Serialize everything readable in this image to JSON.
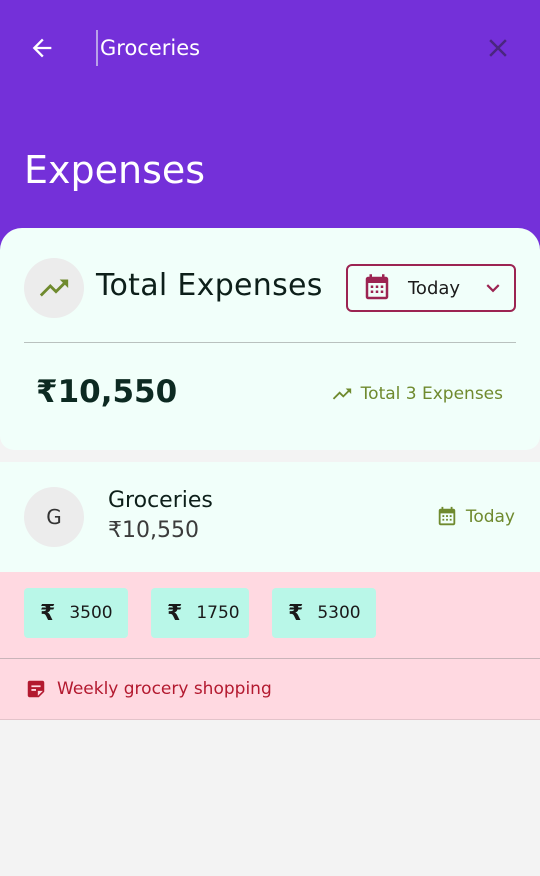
{
  "search": {
    "value": "Groceries",
    "placeholder": ""
  },
  "page": {
    "title": "Expenses"
  },
  "summary": {
    "title": "Total Expenses",
    "date_filter": "Today",
    "total_amount": "₹10,550",
    "count_text": "Total 3 Expenses"
  },
  "expense": {
    "avatar_initial": "G",
    "name": "Groceries",
    "amount": "₹10,550",
    "date": "Today",
    "splits": [
      {
        "currency": "₹",
        "value": "3500"
      },
      {
        "currency": "₹",
        "value": "1750"
      },
      {
        "currency": "₹",
        "value": "5300"
      }
    ],
    "note": "Weekly grocery shopping"
  },
  "colors": {
    "header": "#7430d9",
    "card_bg": "#f1fffa",
    "accent_red": "#9c2452",
    "accent_green": "#6f8a2e",
    "detail_bg": "#ffd9e1",
    "chip_bg": "#b9f7e8"
  },
  "icons": {
    "back": "arrow-left-icon",
    "clear": "close-icon",
    "trend": "trending-up-icon",
    "calendar": "calendar-icon",
    "dropdown": "chevron-down-icon",
    "note": "note-icon"
  }
}
